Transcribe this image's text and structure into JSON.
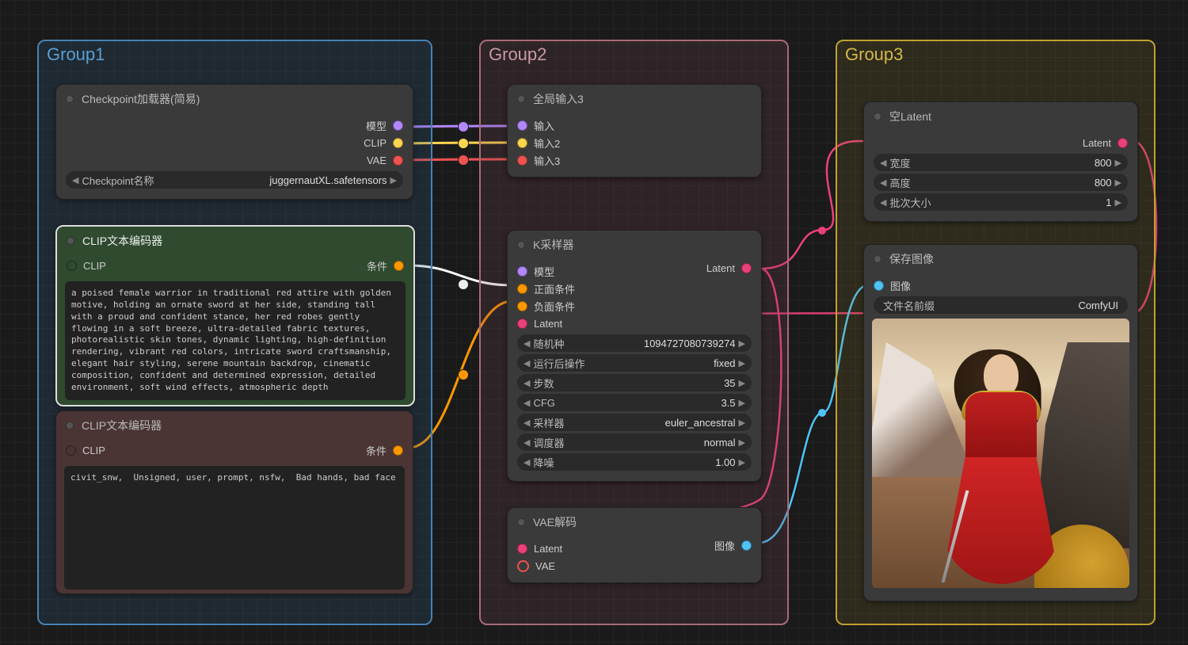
{
  "groups": {
    "g1": "Group1",
    "g2": "Group2",
    "g3": "Group3"
  },
  "checkpoint": {
    "title": "Checkpoint加载器(简易)",
    "out_model": "模型",
    "out_clip": "CLIP",
    "out_vae": "VAE",
    "widget_label": "Checkpoint名称",
    "widget_value": "juggernautXL.safetensors"
  },
  "clip_pos": {
    "title": "CLIP文本编码器",
    "in_clip": "CLIP",
    "out_cond": "条件",
    "text": "a poised female warrior in traditional red attire with golden motive, holding an ornate sword at her side, standing tall with a proud and confident stance, her red robes gently flowing in a soft breeze, ultra-detailed fabric textures, photorealistic skin tones, dynamic lighting, high-definition rendering, vibrant red colors, intricate sword craftsmanship, elegant hair styling, serene mountain backdrop, cinematic composition, confident and determined expression, detailed environment, soft wind effects, atmospheric depth"
  },
  "clip_neg": {
    "title": "CLIP文本编码器",
    "in_clip": "CLIP",
    "out_cond": "条件",
    "text": "civit_snw,  Unsigned, user, prompt, nsfw,  Bad hands, bad face"
  },
  "reroute": {
    "title": "全局输入3",
    "in1": "输入",
    "in2": "输入2",
    "in3": "输入3"
  },
  "ksampler": {
    "title": "K采样器",
    "in_model": "模型",
    "in_pos": "正面条件",
    "in_neg": "负面条件",
    "in_latent": "Latent",
    "out_latent": "Latent",
    "w": [
      {
        "l": "随机种",
        "v": "1094727080739274"
      },
      {
        "l": "运行后操作",
        "v": "fixed"
      },
      {
        "l": "步数",
        "v": "35"
      },
      {
        "l": "CFG",
        "v": "3.5"
      },
      {
        "l": "采样器",
        "v": "euler_ancestral"
      },
      {
        "l": "调度器",
        "v": "normal"
      },
      {
        "l": "降噪",
        "v": "1.00"
      }
    ]
  },
  "vaedec": {
    "title": "VAE解码",
    "in_latent": "Latent",
    "in_vae": "VAE",
    "out_image": "图像"
  },
  "latent": {
    "title": "空Latent",
    "out": "Latent",
    "w": [
      {
        "l": "宽度",
        "v": "800"
      },
      {
        "l": "高度",
        "v": "800"
      },
      {
        "l": "批次大小",
        "v": "1"
      }
    ]
  },
  "save": {
    "title": "保存图像",
    "in_image": "图像",
    "widget_label": "文件名前缀",
    "widget_value": "ComfyUI"
  }
}
